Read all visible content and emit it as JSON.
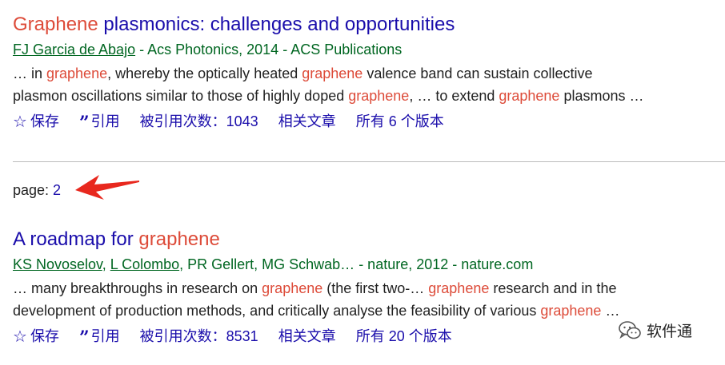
{
  "results": [
    {
      "title_hl": "Graphene",
      "title_rest": " plasmonics: challenges and opportunities",
      "authors": [
        "FJ Garcia de Abajo"
      ],
      "authors_rest": "",
      "source": " - Acs Photonics, 2014 - ACS Publications",
      "snippet_line1": [
        {
          "t": "… in ",
          "hl": false
        },
        {
          "t": "graphene",
          "hl": true
        },
        {
          "t": ", whereby the optically heated ",
          "hl": false
        },
        {
          "t": "graphene",
          "hl": true
        },
        {
          "t": " valence band can sustain collective",
          "hl": false
        }
      ],
      "snippet_line2": [
        {
          "t": "plasmon oscillations similar to those of highly doped ",
          "hl": false
        },
        {
          "t": "graphene",
          "hl": true
        },
        {
          "t": ", … to extend ",
          "hl": false
        },
        {
          "t": "graphene",
          "hl": true
        },
        {
          "t": " plasmons …",
          "hl": false
        }
      ],
      "actions": {
        "save": "保存",
        "cite": "引用",
        "cited_by": "被引用次数：1043",
        "related": "相关文章",
        "versions": "所有 6 个版本"
      }
    },
    {
      "title_hl": "graphene",
      "title_pre": "A roadmap for ",
      "authors": [
        "KS Novoselov",
        "L Colombo"
      ],
      "authors_rest": ", PR Gellert, MG Schwab…",
      "source": " - nature, 2012 - nature.com",
      "snippet_line1": [
        {
          "t": "… many breakthroughs in research on ",
          "hl": false
        },
        {
          "t": "graphene",
          "hl": true
        },
        {
          "t": " (the first two-… ",
          "hl": false
        },
        {
          "t": "graphene",
          "hl": true
        },
        {
          "t": " research and in the",
          "hl": false
        }
      ],
      "snippet_line2": [
        {
          "t": "development of production methods, and critically analyse the feasibility of various ",
          "hl": false
        },
        {
          "t": "graphene",
          "hl": true
        },
        {
          "t": " …",
          "hl": false
        }
      ],
      "actions": {
        "save": "保存",
        "cite": "引用",
        "cited_by": "被引用次数：8531",
        "related": "相关文章",
        "versions": "所有 20 个版本"
      }
    }
  ],
  "pagination": {
    "label": "page: ",
    "number": "2"
  },
  "watermark": {
    "text": "软件通"
  },
  "colors": {
    "link": "#1a0dab",
    "highlight": "#dd4b39",
    "source": "#006621",
    "arrow": "#e8281e"
  },
  "icons": {
    "save": "star-icon",
    "cite": "quote-icon",
    "pointer": "arrow-icon",
    "watermark": "wechat-icon"
  }
}
